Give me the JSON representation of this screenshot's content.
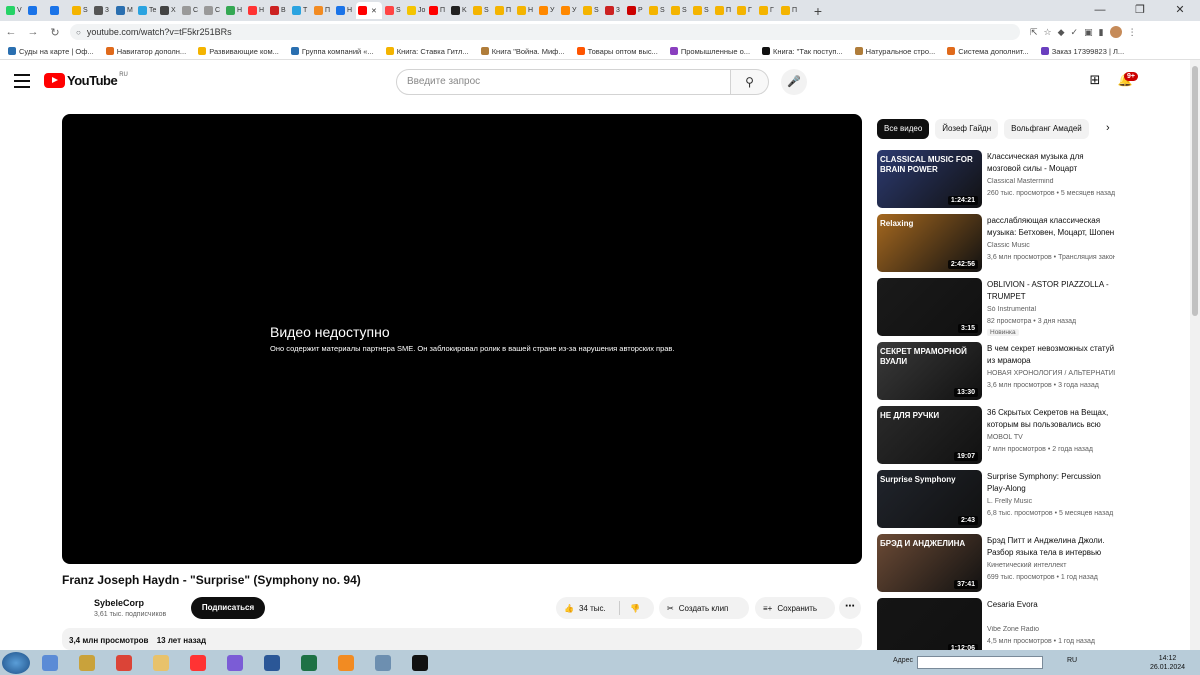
{
  "browser": {
    "tabs": [
      {
        "label": "V",
        "color": "#25d366"
      },
      {
        "label": "",
        "color": "#1a73e8"
      },
      {
        "label": "",
        "color": "#1a73e8"
      },
      {
        "label": "S",
        "color": "#f4b400"
      },
      {
        "label": "3",
        "color": "#555555"
      },
      {
        "label": "M",
        "color": "#2a6fb0"
      },
      {
        "label": "Te",
        "color": "#2aa3e0"
      },
      {
        "label": "X",
        "color": "#444444"
      },
      {
        "label": "C",
        "color": "#999999"
      },
      {
        "label": "C",
        "color": "#999999"
      },
      {
        "label": "H",
        "color": "#34a853"
      },
      {
        "label": "H",
        "color": "#ff3333"
      },
      {
        "label": "B",
        "color": "#cc2222"
      },
      {
        "label": "T",
        "color": "#2aa3e0"
      },
      {
        "label": "П",
        "color": "#f28b22"
      },
      {
        "label": "H",
        "color": "#1a73e8"
      },
      {
        "label": "",
        "color": "#ff0000",
        "active": true
      },
      {
        "label": "S",
        "color": "#ff4444"
      },
      {
        "label": "Jo",
        "color": "#f4c400"
      },
      {
        "label": "П",
        "color": "#ff0000"
      },
      {
        "label": "K",
        "color": "#222222"
      },
      {
        "label": "S",
        "color": "#f4b400"
      },
      {
        "label": "П",
        "color": "#f4b400"
      },
      {
        "label": "H",
        "color": "#f4b400"
      },
      {
        "label": "У",
        "color": "#ff8800"
      },
      {
        "label": "У",
        "color": "#ff8800"
      },
      {
        "label": "S",
        "color": "#f4b400"
      },
      {
        "label": "3",
        "color": "#cc2222"
      },
      {
        "label": "P",
        "color": "#cc0000"
      },
      {
        "label": "S",
        "color": "#f4b400"
      },
      {
        "label": "S",
        "color": "#f4b400"
      },
      {
        "label": "S",
        "color": "#f4b400"
      },
      {
        "label": "П",
        "color": "#f4b400"
      },
      {
        "label": "Г",
        "color": "#f4b400"
      },
      {
        "label": "Г",
        "color": "#f4b400"
      },
      {
        "label": "П",
        "color": "#f4b400"
      }
    ],
    "new_tab": "+",
    "url": "youtube.com/watch?v=tF5kr251BRs",
    "bookmarks": [
      {
        "label": "Суды на карте | Оф...",
        "color": "#2a6fb0"
      },
      {
        "label": "Навигатор дополн...",
        "color": "#e06a1b"
      },
      {
        "label": "Развивающие ком...",
        "color": "#f4b400"
      },
      {
        "label": "Группа компаний «...",
        "color": "#2a6fb0"
      },
      {
        "label": "Книга: Ставка Гитл...",
        "color": "#f4b400"
      },
      {
        "label": "Книга \"Война. Миф...",
        "color": "#b07d3a"
      },
      {
        "label": "Товары оптом выс...",
        "color": "#ff5500"
      },
      {
        "label": "Промышленные о...",
        "color": "#8a3fbf"
      },
      {
        "label": "Книга: \"Так поступ...",
        "color": "#111111"
      },
      {
        "label": "Натуральное стро...",
        "color": "#b07d3a"
      },
      {
        "label": "Система дополнит...",
        "color": "#e06a1b"
      },
      {
        "label": "Заказ 17399823 | Л...",
        "color": "#6a3fbf"
      }
    ]
  },
  "youtube": {
    "logo_word": "YouTube",
    "logo_region": "RU",
    "search_placeholder": "Введите запрос",
    "notifications_badge": "9+",
    "player": {
      "title": "Видео недоступно",
      "message": "Оно содержит материалы партнера SME. Он заблокировал ролик в вашей стране из-за нарушения авторских прав."
    },
    "video": {
      "title": "Franz Joseph Haydn - \"Surprise\" (Symphony no. 94)",
      "channel": "SybeleCorp",
      "subscribers": "3,61 тыс. подписчиков",
      "subscribe_label": "Подписаться",
      "likes": "34 тыс.",
      "clip_label": "Создать клип",
      "save_label": "Сохранить",
      "views": "3,4 млн просмотров",
      "age": "13 лет назад"
    },
    "chips": [
      "Все видео",
      "Йозеф Гайдн",
      "Вольфганг Амадей"
    ],
    "recommendations": [
      {
        "title": "Классическая музыка для мозговой силы - Моцарт",
        "channel": "Classical Mastermind",
        "meta": "260 тыс. просмотров • 5 месяцев назад",
        "duration": "1:24:21",
        "thumb_text": "CLASSICAL MUSIC FOR BRAIN POWER",
        "bg": "#2c3a70"
      },
      {
        "title": "расслабляющая классическая музыка: Бетховен, Моцарт, Шопен",
        "channel": "Classic Music",
        "meta": "3,6 млн просмотров • Трансляция закончилась",
        "duration": "2:42:56",
        "thumb_text": "Relaxing",
        "bg": "#a5681f"
      },
      {
        "title": "OBLIVION - ASTOR PIAZZOLLA - TRUMPET",
        "channel": "Só Instrumental",
        "meta": "82 просмотра • 3 дня назад",
        "duration": "3:15",
        "thumb_text": "",
        "bg": "#1a1a1a",
        "badge": "Новинка"
      },
      {
        "title": "В чем секрет невозможных статуй из мрамора",
        "channel": "НОВАЯ ХРОНОЛОГИЯ / АЛЬТЕРНАТИВНАЯ ИСТОРИЯ",
        "meta": "3,6 млн просмотров • 3 года назад",
        "duration": "13:30",
        "thumb_text": "СЕКРЕТ МРАМОРНОЙ ВУАЛИ",
        "bg": "#3a3a3a"
      },
      {
        "title": "36 Скрытых Секретов на Вещах, которым вы пользовались всю жизнь",
        "channel": "MOBOL TV",
        "meta": "7 млн просмотров • 2 года назад",
        "duration": "19:07",
        "thumb_text": "НЕ ДЛЯ РУЧКИ",
        "bg": "#2a2a2a"
      },
      {
        "title": "Surprise Symphony: Percussion Play-Along",
        "channel": "L. Frelly Music",
        "meta": "6,8 тыс. просмотров • 5 месяцев назад",
        "duration": "2:43",
        "thumb_text": "Surprise Symphony",
        "bg": "#20242c"
      },
      {
        "title": "Брэд Питт и Анджелина Джоли. Разбор языка тела в интервью",
        "channel": "Кинетический интеллект",
        "meta": "699 тыс. просмотров • 1 год назад",
        "duration": "37:41",
        "thumb_text": "БРЭД И АНДЖЕЛИНА",
        "bg": "#6b4a35"
      },
      {
        "title": "Cesaria Evora",
        "channel": "Vibe Zone Radio",
        "meta": "4,5 млн просмотров • 1 год назад",
        "duration": "1:12:06",
        "thumb_text": "",
        "bg": "#151515"
      }
    ]
  },
  "taskbar": {
    "address_label": "Адрес",
    "language": "RU",
    "time": "14:12",
    "date": "26.01.2024",
    "apps": [
      {
        "color": "#5b8bd6"
      },
      {
        "color": "#c9a23b"
      },
      {
        "color": "#db4437"
      },
      {
        "color": "#e8c26b"
      },
      {
        "color": "#ff3333"
      },
      {
        "color": "#7b5cd6"
      },
      {
        "color": "#2b5797"
      },
      {
        "color": "#1e7145"
      },
      {
        "color": "#f28b22"
      },
      {
        "color": "#6d8fb0"
      },
      {
        "color": "#111111"
      }
    ]
  }
}
